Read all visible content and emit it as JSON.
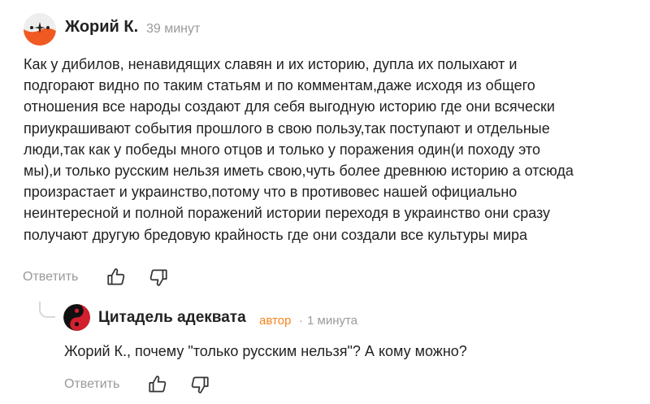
{
  "comment": {
    "author": "Жорий К.",
    "time": "39 минут",
    "text_lines": [
      "Как у дибилов, ненавидящих славян и их историю, дупла их полыхают и",
      "подгорают видно по таким статьям и по комментам,даже исходя из общего",
      "отношения все народы создают для себя выгодную историю где они всячески",
      "приукрашивают события прошлого в свою пользу,так поступают и отдельные",
      "люди,так как у победы много отцов и только у поражения один(и походу это",
      "мы),и только русским нельзя иметь свою,чуть более древнюю историю а отсюда",
      "произрастает и украинство,потому что в противовес нашей официально",
      "неинтересной и полной поражений истории переходя в украинство они сразу",
      "получают другую бредовую крайность где они создали все культуры мира"
    ],
    "reply_label": "Ответить",
    "like_icon": "thumbs-up-icon",
    "dislike_icon": "thumbs-down-icon"
  },
  "reply": {
    "author": "Цитадель адеквата",
    "badge": "автор",
    "separator": "·",
    "time": "1 минута",
    "text": "Жорий К., почему \"только русским нельзя\"? А кому можно?",
    "reply_label": "Ответить",
    "like_icon": "thumbs-up-icon",
    "dislike_icon": "thumbs-down-icon"
  },
  "colors": {
    "text": "#222222",
    "muted": "#999999",
    "badge": "#f6851f",
    "avatar_orange": "#f05a22"
  }
}
